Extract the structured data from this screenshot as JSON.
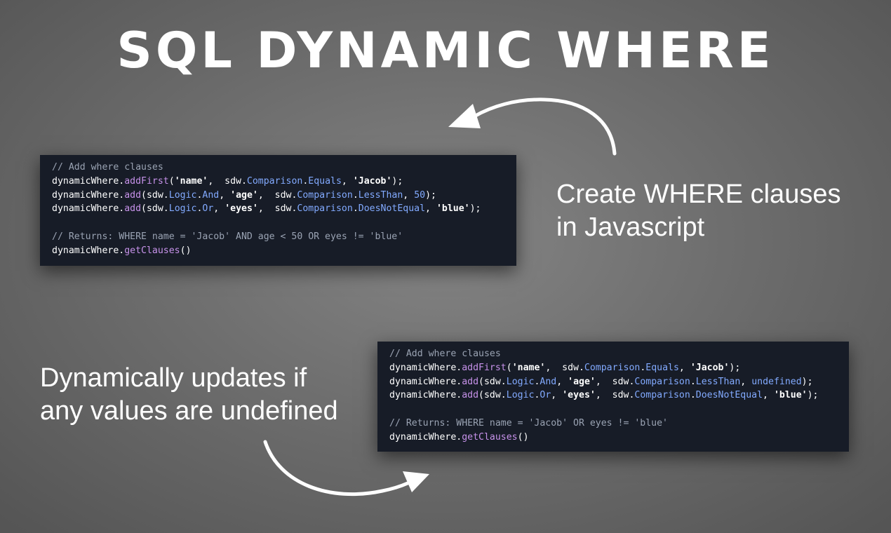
{
  "title": "SQL DYNAMIC WHERE",
  "caption_top": {
    "line1": "Create WHERE clauses",
    "line2": "in Javascript"
  },
  "caption_bottom": {
    "line1": "Dynamically updates if",
    "line2": "any values are undefined"
  },
  "code_top": {
    "comment1": "// Add where clauses",
    "line1": {
      "obj": "dynamicWhere.",
      "method": "addFirst",
      "open": "(",
      "arg1": "'name'",
      "sep1": ",  sdw.",
      "ns": "Comparison",
      "dot": ".",
      "op": "Equals",
      "sep2": ", ",
      "arg2": "'Jacob'",
      "close": ");"
    },
    "line2": {
      "obj": "dynamicWhere.",
      "method": "add",
      "open": "(sdw.",
      "ns1": "Logic",
      "dot1": ".",
      "logic": "And",
      "sep1": ", ",
      "field": "'age'",
      "sep2": ",  sdw.",
      "ns2": "Comparison",
      "dot2": ".",
      "op": "LessThan",
      "sep3": ", ",
      "value": "50",
      "close": ");"
    },
    "line3": {
      "obj": "dynamicWhere.",
      "method": "add",
      "open": "(sdw.",
      "ns1": "Logic",
      "dot1": ".",
      "logic": "Or",
      "sep1": ", ",
      "field": "'eyes'",
      "sep2": ",  sdw.",
      "ns2": "Comparison",
      "dot2": ".",
      "op": "DoesNotEqual",
      "sep3": ", ",
      "value": "'blue'",
      "close": ");"
    },
    "comment2": "// Returns: WHERE name = 'Jacob' AND age < 50 OR eyes != 'blue'",
    "line4": {
      "obj": "dynamicWhere.",
      "method": "getClauses",
      "close": "()"
    }
  },
  "code_bottom": {
    "comment1": "// Add where clauses",
    "line1": {
      "obj": "dynamicWhere.",
      "method": "addFirst",
      "open": "(",
      "arg1": "'name'",
      "sep1": ",  sdw.",
      "ns": "Comparison",
      "dot": ".",
      "op": "Equals",
      "sep2": ", ",
      "arg2": "'Jacob'",
      "close": ");"
    },
    "line2": {
      "obj": "dynamicWhere.",
      "method": "add",
      "open": "(sdw.",
      "ns1": "Logic",
      "dot1": ".",
      "logic": "And",
      "sep1": ", ",
      "field": "'age'",
      "sep2": ",  sdw.",
      "ns2": "Comparison",
      "dot2": ".",
      "op": "LessThan",
      "sep3": ", ",
      "value": "undefined",
      "close": ");"
    },
    "line3": {
      "obj": "dynamicWhere.",
      "method": "add",
      "open": "(sdw.",
      "ns1": "Logic",
      "dot1": ".",
      "logic": "Or",
      "sep1": ", ",
      "field": "'eyes'",
      "sep2": ",  sdw.",
      "ns2": "Comparison",
      "dot2": ".",
      "op": "DoesNotEqual",
      "sep3": ", ",
      "value": "'blue'",
      "close": ");"
    },
    "comment2": "// Returns: WHERE name = 'Jacob' OR eyes != 'blue'",
    "line4": {
      "obj": "dynamicWhere.",
      "method": "getClauses",
      "close": "()"
    }
  },
  "colors": {
    "background": "#6e6e6e",
    "code_background": "#171c27",
    "comment": "#9aa3b3",
    "method": "#c792ea",
    "keyword": "#82aaff",
    "text": "#ffffff"
  }
}
